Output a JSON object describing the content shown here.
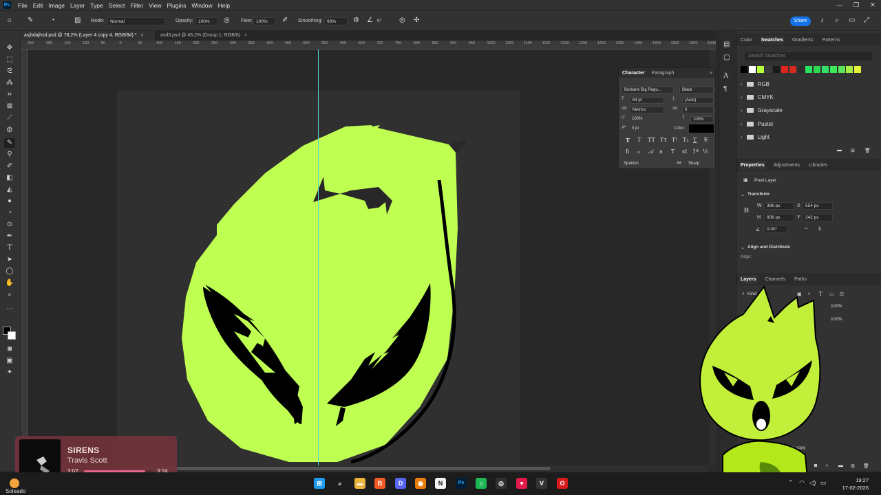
{
  "app": {
    "logo": "Ps",
    "menu": [
      "File",
      "Edit",
      "Image",
      "Layer",
      "Type",
      "Select",
      "Filter",
      "View",
      "Plugins",
      "Window",
      "Help"
    ],
    "window_controls": [
      "—",
      "❐",
      "✕"
    ]
  },
  "options": {
    "mode_label": "Mode:",
    "mode_value": "Normal",
    "opacity_label": "Opacity:",
    "opacity_value": "100%",
    "flow_label": "Flow:",
    "flow_value": "100%",
    "smoothing_label": "Smoothing:",
    "smoothing_value": "93%",
    "angle_value": "0°",
    "share_label": "Share"
  },
  "tabs": [
    {
      "label": "asjhdajhsd.psd @ 78,2% (Layer 4 copy 4, RGB/8#) *",
      "active": true
    },
    {
      "label": "asd3.psd @ 45,2% (Group 1, RGB/8)",
      "active": false
    }
  ],
  "ruler": [
    "250",
    "200",
    "150",
    "100",
    "50",
    "0",
    "50",
    "100",
    "150",
    "200",
    "250",
    "300",
    "350",
    "400",
    "450",
    "500",
    "550",
    "600",
    "650",
    "700",
    "750",
    "800",
    "850",
    "900",
    "950",
    "1000",
    "1050",
    "1100",
    "1150",
    "1200",
    "1250",
    "1300",
    "1350",
    "1400",
    "1450",
    "1500",
    "1550",
    "1600"
  ],
  "character": {
    "tabs": [
      "Character",
      "Paragraph"
    ],
    "font_family": "Burbank Big Regu...",
    "font_style": "Black",
    "size": "64 pt",
    "leading": "(Auto)",
    "kerning": "Metrics",
    "tracking": "0",
    "vscale": "100%",
    "hscale": "100%",
    "baseline": "0 pt",
    "color_label": "Color:",
    "language": "Spanish",
    "antialias": "Sharp"
  },
  "swatches": {
    "tabs": [
      "Color",
      "Swatches",
      "Gradients",
      "Patterns"
    ],
    "active_tab": "Swatches",
    "search_placeholder": "Search Swatches",
    "colors": [
      "#000000",
      "#ffffff",
      "#b8ff3c",
      "#3a3a3a",
      "#1a1a1a",
      "#e0261f",
      "#d62a20",
      "#2d2d2d",
      "#27e35f",
      "#2fd94f",
      "#35e066",
      "#3ee85a",
      "#5fe55a",
      "#a6f044",
      "#e6f23a"
    ],
    "folders": [
      "RGB",
      "CMYK",
      "Grayscale",
      "Pastel",
      "Light"
    ]
  },
  "properties": {
    "tabs": [
      "Properties",
      "Adjustments",
      "Libraries"
    ],
    "layer_kind": "Pixel Layer",
    "transform_label": "Transform",
    "w_label": "W",
    "w": "396 px",
    "h_label": "H",
    "h": "808 px",
    "x_label": "X",
    "x": "554 px",
    "y_label": "Y",
    "y": "242 px",
    "angle": "0,00°",
    "align_header": "Align and Distribute",
    "align_label": "Align:"
  },
  "layers": {
    "tabs": [
      "Layers",
      "Channels",
      "Paths"
    ],
    "filter_label": "Kind",
    "opacity": "100%",
    "fill": "100%",
    "bottom_layer": "Ellipse 1 copy"
  },
  "media": {
    "title": "SIRENS",
    "artist": "Travis Scott",
    "elapsed": "3:02",
    "duration": "3:24",
    "progress": 0.89
  },
  "taskbar": {
    "weather": "Soleado",
    "time": "19:27",
    "date": "17-02-2026",
    "apps": [
      {
        "name": "windows-start",
        "glyph": "⊞",
        "color": "#1e9bf0"
      },
      {
        "name": "search",
        "glyph": "⌕",
        "color": "transparent"
      },
      {
        "name": "file-explorer",
        "glyph": "▬",
        "color": "#e8b43b"
      },
      {
        "name": "brave",
        "glyph": "B",
        "color": "#f05a24"
      },
      {
        "name": "discord",
        "glyph": "D",
        "color": "#5865f2"
      },
      {
        "name": "blender",
        "glyph": "◉",
        "color": "#e87d0d"
      },
      {
        "name": "notion",
        "glyph": "N",
        "color": "#f5f5f5"
      },
      {
        "name": "photoshop",
        "glyph": "Ps",
        "color": "#001e36"
      },
      {
        "name": "spotify",
        "glyph": "♫",
        "color": "#1db954"
      },
      {
        "name": "obs",
        "glyph": "◎",
        "color": "#303030"
      },
      {
        "name": "app-red",
        "glyph": "♥",
        "color": "#e3194b"
      },
      {
        "name": "app-vector",
        "glyph": "V",
        "color": "#333333"
      },
      {
        "name": "opera",
        "glyph": "O",
        "color": "#d91b1b"
      }
    ]
  }
}
